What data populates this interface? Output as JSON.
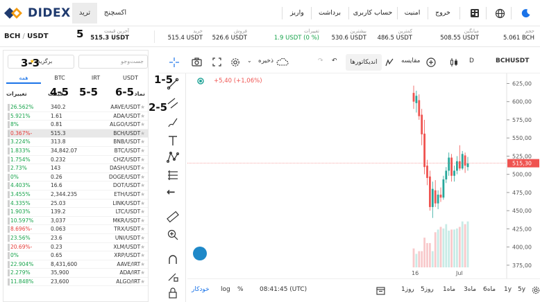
{
  "header": {
    "brand": "DIDEX",
    "tabs": [
      {
        "label": "ترید"
      },
      {
        "label": "اکسچنج"
      }
    ],
    "nav": [
      "خروج",
      "امنیت",
      "حساب کاربری",
      "برداشت",
      "واریز"
    ]
  },
  "ticker": {
    "pair_base": "BCH",
    "pair_quote": "USDT",
    "items": [
      {
        "label": "آخرین قیمت",
        "value": "515.3 USDT",
        "color": ""
      },
      {
        "label": "خرید",
        "value": "515.4 USDT",
        "color": ""
      },
      {
        "label": "فروش",
        "value": "526.6 USDT",
        "color": ""
      },
      {
        "label": "تغییرات",
        "value": "1.9 USDT (0 %)",
        "color": "#16a34a"
      },
      {
        "label": "بیشترین",
        "value": "530.6 USDT",
        "color": ""
      },
      {
        "label": "کمترین",
        "value": "486.5 USDT",
        "color": ""
      },
      {
        "label": "میانگین",
        "value": "508.55 USDT",
        "color": ""
      },
      {
        "label": "حجم",
        "value": "5.061 BCH",
        "color": ""
      }
    ]
  },
  "market": {
    "search_placeholder": "جست‌وجو",
    "favorites_label": "برگزیده",
    "quote_tabs": [
      "USDT",
      "IRT",
      "BTC",
      "همه"
    ],
    "col_symbol": "نماد",
    "col_price": "قیمت",
    "col_change": "تغییرات",
    "rows": [
      {
        "sym": "AAVE/USDT",
        "price": "340.2",
        "change": "26.562%",
        "dir": "pos"
      },
      {
        "sym": "ADA/USDT",
        "price": "1.61",
        "change": "5.921%",
        "dir": "pos"
      },
      {
        "sym": "ALGO/USDT",
        "price": "0.81",
        "change": "8%",
        "dir": "pos"
      },
      {
        "sym": "BCH/USDT",
        "price": "515.3",
        "change": "0.367%-",
        "dir": "neg",
        "highlight": true
      },
      {
        "sym": "BNB/USDT",
        "price": "313.8",
        "change": "3.224%",
        "dir": "pos"
      },
      {
        "sym": "BTC/USDT",
        "price": "34,842.07",
        "change": "1.833%",
        "dir": "pos"
      },
      {
        "sym": "CHZ/USDT",
        "price": "0.232",
        "change": "1.754%",
        "dir": "pos"
      },
      {
        "sym": "DASH/USDT",
        "price": "143",
        "change": "2.73%",
        "dir": "pos"
      },
      {
        "sym": "DOGE/USDT",
        "price": "0.26",
        "change": "0%",
        "dir": "pos"
      },
      {
        "sym": "DOT/USDT",
        "price": "16.6",
        "change": "4.403%",
        "dir": "pos"
      },
      {
        "sym": "ETH/USDT",
        "price": "2,344.235",
        "change": "3.455%",
        "dir": "pos"
      },
      {
        "sym": "LINK/USDT",
        "price": "25.03",
        "change": "4.335%",
        "dir": "pos"
      },
      {
        "sym": "LTC/USDT",
        "price": "139.2",
        "change": "1.903%",
        "dir": "pos"
      },
      {
        "sym": "MKR/USDT",
        "price": "3,037",
        "change": "10.597%",
        "dir": "pos"
      },
      {
        "sym": "TRX/USDT",
        "price": "0.063",
        "change": "8.696%-",
        "dir": "neg"
      },
      {
        "sym": "UNI/USDT",
        "price": "23.6",
        "change": "23.56%",
        "dir": "pos"
      },
      {
        "sym": "XLM/USDT",
        "price": "0.23",
        "change": "20.69%-",
        "dir": "neg"
      },
      {
        "sym": "XRP/USDT",
        "price": "0.65",
        "change": "0%",
        "dir": "pos"
      },
      {
        "sym": "AAVE/IRT",
        "price": "8,431,600",
        "change": "22.904%",
        "dir": "pos"
      },
      {
        "sym": "ADA/IRT",
        "price": "35,900",
        "change": "2.279%",
        "dir": "pos"
      },
      {
        "sym": "ALGO/IRT",
        "price": "23,600",
        "change": "11.848%",
        "dir": "pos"
      }
    ]
  },
  "annotations": [
    "3-3",
    "4-5",
    "5-5",
    "6-5",
    "1-5",
    "2-5",
    "5"
  ],
  "toolbar": {
    "symbol": "BCHUSDT",
    "interval": "D",
    "compare_label": "مقایسه",
    "indicators_label": "اندیکاتورها",
    "save_label": "ذخیره"
  },
  "legend": {
    "change": "+5,40 (+1,06%)"
  },
  "chart_data": {
    "type": "candlestick",
    "yticks": [
      625,
      600,
      575,
      550,
      525,
      500,
      475,
      450,
      425,
      400,
      375
    ],
    "ylim": [
      372,
      635
    ],
    "last_price_label": "515,30",
    "last_price": 515.3,
    "xticks": [
      "16",
      "Jul"
    ],
    "up_color": "#26a69a",
    "down_color": "#ef5350",
    "candles": [
      {
        "o": 612,
        "h": 622,
        "l": 590,
        "c": 600
      },
      {
        "o": 598,
        "h": 615,
        "l": 585,
        "c": 608
      },
      {
        "o": 602,
        "h": 610,
        "l": 575,
        "c": 580
      },
      {
        "o": 582,
        "h": 590,
        "l": 540,
        "c": 555
      },
      {
        "o": 556,
        "h": 575,
        "l": 500,
        "c": 510
      },
      {
        "o": 512,
        "h": 520,
        "l": 485,
        "c": 495
      },
      {
        "o": 497,
        "h": 505,
        "l": 450,
        "c": 455
      },
      {
        "o": 455,
        "h": 490,
        "l": 440,
        "c": 480
      },
      {
        "o": 478,
        "h": 492,
        "l": 455,
        "c": 460
      },
      {
        "o": 460,
        "h": 478,
        "l": 452,
        "c": 472
      },
      {
        "o": 472,
        "h": 482,
        "l": 462,
        "c": 468
      },
      {
        "o": 468,
        "h": 498,
        "l": 465,
        "c": 493
      },
      {
        "o": 493,
        "h": 510,
        "l": 488,
        "c": 505
      },
      {
        "o": 505,
        "h": 530,
        "l": 498,
        "c": 523
      },
      {
        "o": 523,
        "h": 528,
        "l": 490,
        "c": 498
      },
      {
        "o": 498,
        "h": 512,
        "l": 490,
        "c": 505
      },
      {
        "o": 505,
        "h": 525,
        "l": 500,
        "c": 518
      },
      {
        "o": 518,
        "h": 540,
        "l": 505,
        "c": 508
      },
      {
        "o": 508,
        "h": 532,
        "l": 506,
        "c": 528
      },
      {
        "o": 526,
        "h": 530,
        "l": 502,
        "c": 512
      },
      {
        "o": 510,
        "h": 524,
        "l": 505,
        "c": 515
      }
    ],
    "volumes": [
      0.35,
      0.25,
      0.3,
      0.3,
      0.55,
      0.45,
      0.45,
      0.3,
      0.65,
      0.7,
      0.75,
      0.72,
      0.8,
      0.68,
      0.7,
      0.7,
      0.72,
      0.75,
      0.85,
      0.8,
      0.85
    ]
  },
  "bottom": {
    "ranges": [
      "5y",
      "1y",
      "6ماه",
      "3ماه",
      "1ماه",
      "5روز",
      "1روز"
    ],
    "time": "08:41:45 (UTC)",
    "pct": "%",
    "log": "log",
    "auto": "خودکار"
  }
}
